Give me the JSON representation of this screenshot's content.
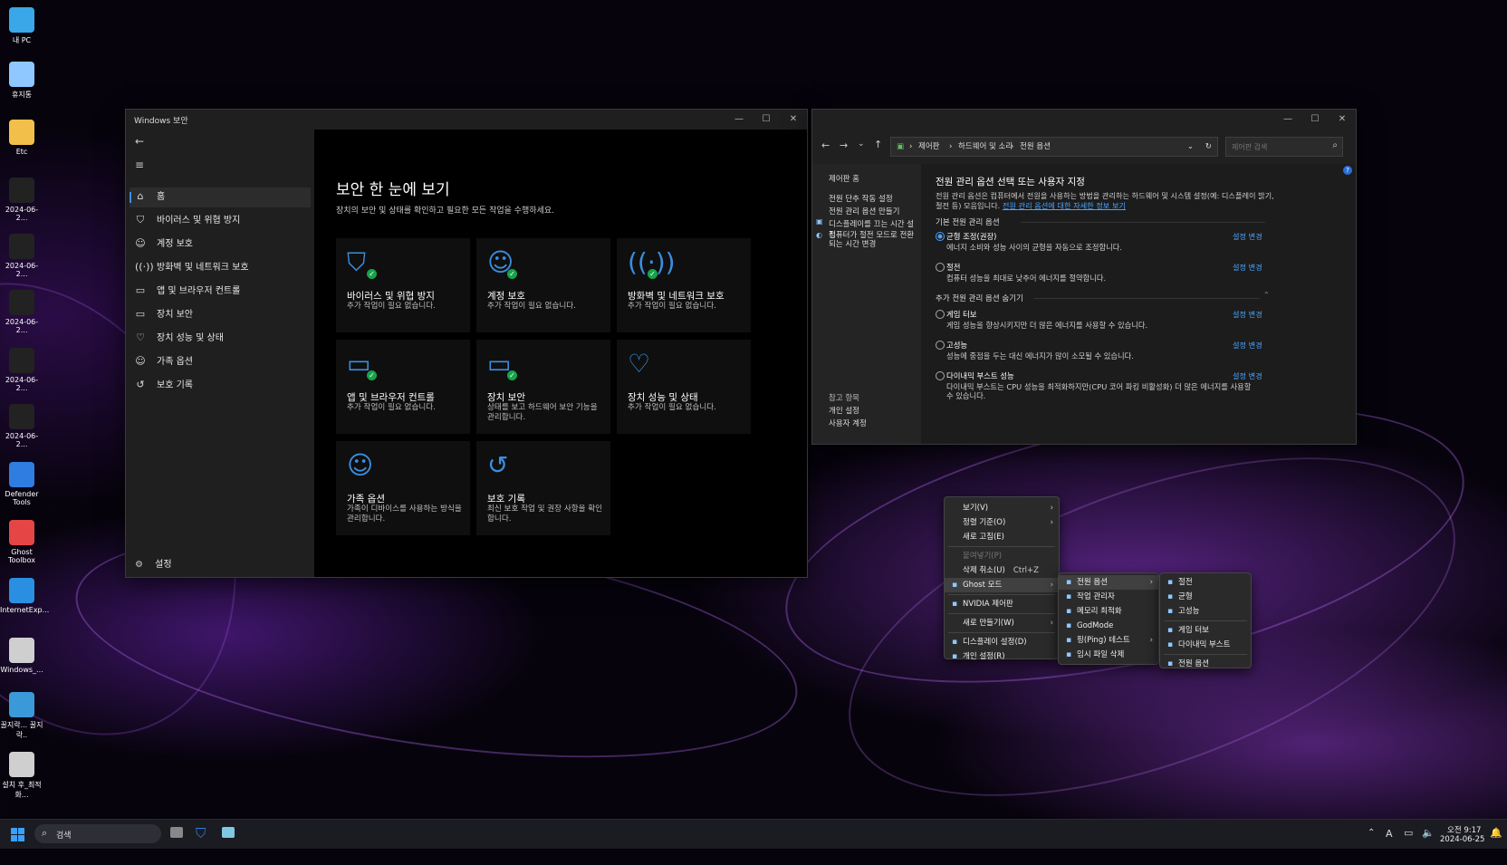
{
  "desktop": {
    "icons": [
      {
        "label": "내 PC",
        "icon": "monitor-icon",
        "color": "#39a7e8"
      },
      {
        "label": "휴지통",
        "icon": "recycle-bin-icon",
        "color": "#8fc8ff"
      },
      {
        "label": "Etc",
        "icon": "folder-icon",
        "color": "#f2c04a"
      },
      {
        "label": "2024-06-2...",
        "icon": "image-file-icon",
        "color": "#222222"
      },
      {
        "label": "2024-06-2...",
        "icon": "image-file-icon",
        "color": "#222222"
      },
      {
        "label": "2024-06-2...",
        "icon": "image-file-icon",
        "color": "#222222"
      },
      {
        "label": "2024-06-2...",
        "icon": "image-file-icon",
        "color": "#222222"
      },
      {
        "label": "2024-06-2...",
        "icon": "image-file-icon",
        "color": "#222222"
      },
      {
        "label": "Defender Tools",
        "icon": "shield-icon",
        "color": "#2f7de1"
      },
      {
        "label": "Ghost Toolbox",
        "icon": "ghost-box-icon",
        "color": "#e64545"
      },
      {
        "label": "InternetExp...",
        "icon": "ie-icon",
        "color": "#2a8fe0"
      },
      {
        "label": "Windows_...",
        "icon": "settings-file-icon",
        "color": "#cfcfcf"
      },
      {
        "label": "꿀지락... 꿀지락..",
        "icon": "globe-icon",
        "color": "#3a9ad9"
      },
      {
        "label": "설치 후_최적화...",
        "icon": "settings-file-icon",
        "color": "#cfcfcf"
      }
    ]
  },
  "security": {
    "title": "Windows 보안",
    "nav": [
      {
        "label": "홈",
        "icon": "home-icon",
        "glyph": "⌂"
      },
      {
        "label": "바이러스 및 위협 방지",
        "icon": "shield-outline-icon",
        "glyph": "⛉"
      },
      {
        "label": "계정 보호",
        "icon": "person-icon",
        "glyph": "☺"
      },
      {
        "label": "방화벽 및 네트워크 보호",
        "icon": "antenna-icon",
        "glyph": "((·))"
      },
      {
        "label": "앱 및 브라우저 컨트롤",
        "icon": "app-window-icon",
        "glyph": "▭"
      },
      {
        "label": "장치 보안",
        "icon": "laptop-icon",
        "glyph": "▭"
      },
      {
        "label": "장치 성능 및 상태",
        "icon": "heart-pulse-icon",
        "glyph": "♡"
      },
      {
        "label": "가족 옵션",
        "icon": "family-icon",
        "glyph": "☺"
      },
      {
        "label": "보호 기록",
        "icon": "history-icon",
        "glyph": "↺"
      }
    ],
    "settings_label": "설정",
    "heading": "보안 한 눈에 보기",
    "subheading": "장치의 보안 및 상태를 확인하고 필요한 모든 작업을 수행하세요.",
    "cards": [
      {
        "title": "바이러스 및 위협 방지",
        "desc": "추가 작업이 필요 없습니다.",
        "icon": "shield-check-icon",
        "ok": true
      },
      {
        "title": "계정 보호",
        "desc": "추가 작업이 필요 없습니다.",
        "icon": "person-check-icon",
        "ok": true
      },
      {
        "title": "방화벽 및 네트워크 보호",
        "desc": "추가 작업이 필요 없습니다.",
        "icon": "antenna-check-icon",
        "ok": true
      },
      {
        "title": "앱 및 브라우저 컨트롤",
        "desc": "추가 작업이 필요 없습니다.",
        "icon": "app-window-check-icon",
        "ok": true
      },
      {
        "title": "장치 보안",
        "desc": "상태를 보고 하드웨어 보안 기능을 관리합니다.",
        "icon": "laptop-check-icon",
        "ok": true
      },
      {
        "title": "장치 성능 및 상태",
        "desc": "추가 작업이 필요 없습니다.",
        "icon": "heart-pulse-icon",
        "ok": false
      },
      {
        "title": "가족 옵션",
        "desc": "가족이 디바이스를 사용하는 방식을 관리합니다.",
        "icon": "family-icon",
        "ok": false
      },
      {
        "title": "보호 기록",
        "desc": "최신 보호 작업 및 권장 사항을 확인합니다.",
        "icon": "history-icon",
        "ok": false
      }
    ],
    "accent": "#3b8ee0",
    "ok_color": "#16a34a"
  },
  "power": {
    "breadcrumb": [
      "제어판",
      "하드웨어 및 소리",
      "전원 옵션"
    ],
    "search_placeholder": "제어판 검색",
    "sidebar": {
      "home": "제어판 홈",
      "links": [
        "전원 단추 작동 설정",
        "전원 관리 옵션 만들기",
        "디스플레이를 끄는 시간 설정",
        "컴퓨터가 절전 모드로 전환되는 시간 변경"
      ],
      "see_also_title": "참고 항목",
      "see_also": [
        "개인 설정",
        "사용자 계정"
      ]
    },
    "title": "전원 관리 옵션 선택 또는 사용자 지정",
    "intro": "전원 관리 옵션은 컴퓨터에서 전원을 사용하는 방법을 관리하는 하드웨어 및 시스템 설정(예: 디스플레이 밝기, 절전 등) 모음입니다.",
    "intro_link": "전원 관리 옵션에 대한 자세한 정보 보기",
    "basic_title": "기본 전원 관리 옵션",
    "extra_title": "추가 전원 관리 옵션 숨기기",
    "change_label": "설정 변경",
    "plans": [
      {
        "name": "균형 조정(권장)",
        "desc": "에너지 소비와 성능 사이의 균형을 자동으로 조정합니다.",
        "selected": true
      },
      {
        "name": "절전",
        "desc": "컴퓨터 성능을 최대로 낮추어 에너지를 절약합니다.",
        "selected": false
      }
    ],
    "extra_plans": [
      {
        "name": "게임 터보",
        "desc": "게임 성능을 향상시키지만 더 많은 에너지를 사용할 수 있습니다.",
        "selected": false
      },
      {
        "name": "고성능",
        "desc": "성능에 중점을 두는 대신 에너지가 많이 소모될 수 있습니다.",
        "selected": false
      },
      {
        "name": "다이내믹 부스트 성능",
        "desc": "다이내믹 부스트는 CPU 성능을 최적화하지만(CPU 코어 파킹 비활성화) 더 많은 에너지를 사용할 수 있습니다.",
        "selected": false
      }
    ]
  },
  "context_menu": {
    "items": [
      {
        "label": "보기(V)",
        "arrow": true
      },
      {
        "label": "정렬 기준(O)",
        "arrow": true
      },
      {
        "label": "새로 고침(E)"
      },
      {
        "sep": true
      },
      {
        "label": "붙여넣기(P)",
        "disabled": true
      },
      {
        "label": "삭제 취소(U)",
        "shortcut": "Ctrl+Z"
      },
      {
        "label": "Ghost 모드",
        "arrow": true,
        "highlight": true,
        "icon": "ghost-icon"
      },
      {
        "sep": true
      },
      {
        "label": "NVIDIA 제어판",
        "icon": "nvidia-icon"
      },
      {
        "sep": true
      },
      {
        "label": "새로 만들기(W)",
        "arrow": true
      },
      {
        "sep": true
      },
      {
        "label": "디스플레이 설정(D)",
        "icon": "display-icon"
      },
      {
        "label": "개인 설정(R)",
        "icon": "brush-icon"
      }
    ],
    "sub1": [
      {
        "label": "전원 옵션",
        "arrow": true,
        "highlight": true,
        "icon": "power-options-icon"
      },
      {
        "label": "작업 관리자",
        "icon": "task-manager-icon"
      },
      {
        "label": "메모리 최적화",
        "icon": "memory-icon"
      },
      {
        "label": "GodMode",
        "icon": "godmode-icon"
      },
      {
        "label": "핑(Ping) 테스트",
        "arrow": true,
        "icon": "ping-icon"
      },
      {
        "label": "임시 파일 삭제",
        "icon": "broom-icon"
      }
    ],
    "sub2": [
      {
        "label": "절전",
        "icon": "bolt-icon"
      },
      {
        "label": "균형",
        "icon": "bolt-icon"
      },
      {
        "label": "고성능",
        "icon": "bolt-icon"
      },
      {
        "sep": true
      },
      {
        "label": "게임 터보",
        "icon": "gamepad-icon"
      },
      {
        "label": "다이내믹 부스트",
        "icon": "boost-icon"
      },
      {
        "sep": true
      },
      {
        "label": "전원 옵션",
        "icon": "power-options-icon"
      }
    ]
  },
  "taskbar": {
    "search_label": "검색",
    "time": "오전 9:17",
    "date": "2024-06-25",
    "ime": "A"
  }
}
